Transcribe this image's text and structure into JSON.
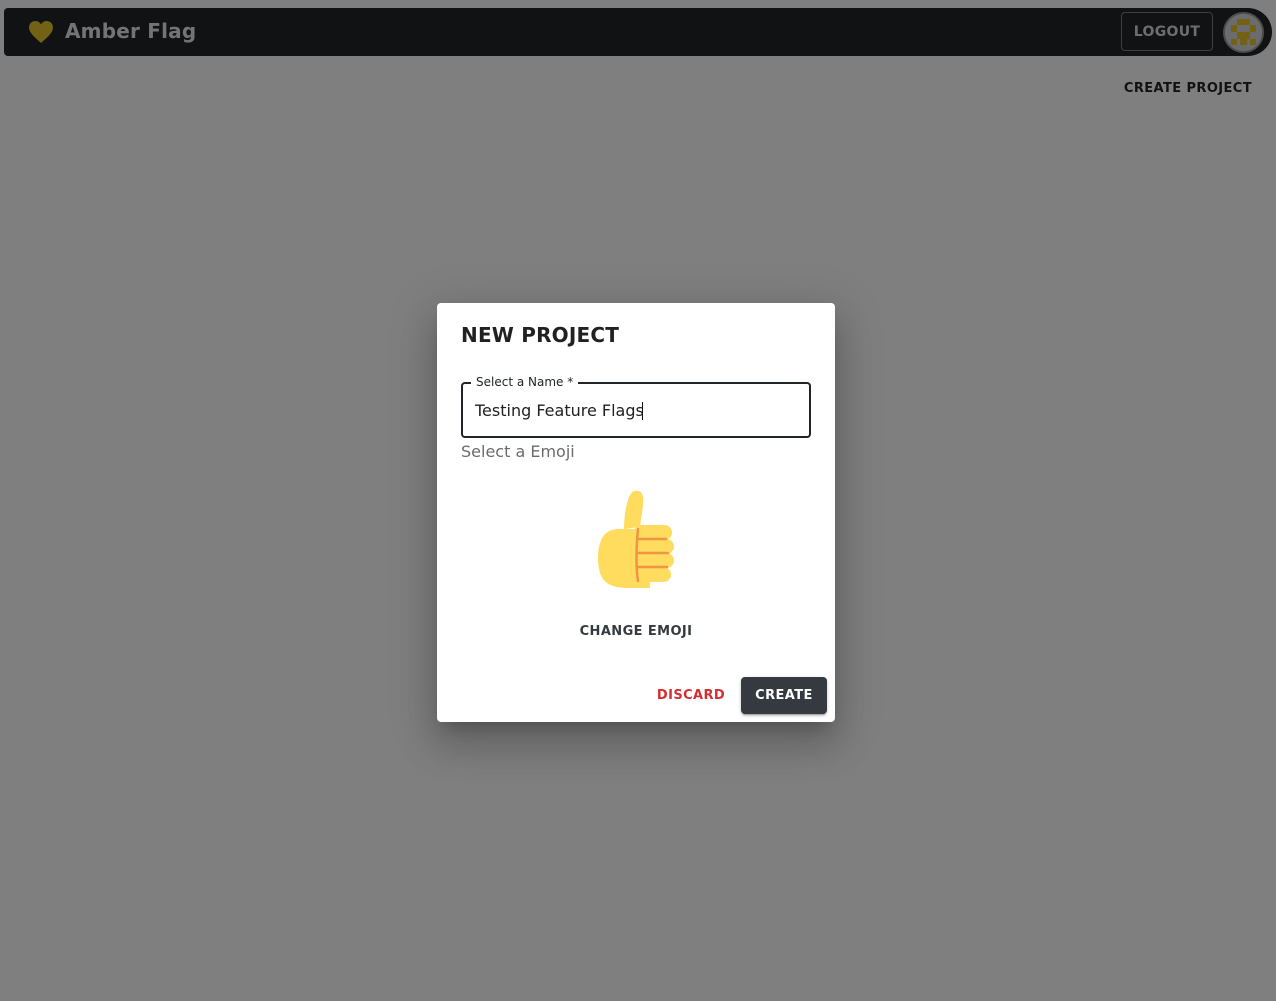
{
  "app": {
    "brand_name": "Amber Flag",
    "brand_icon": "heart-icon",
    "brand_color": "#e7c32b",
    "logout_label": "LOGOUT",
    "avatar_icon": "identicon-avatar",
    "create_project_label": "CREATE PROJECT"
  },
  "dialog": {
    "title": "NEW PROJECT",
    "name_field": {
      "label": "Select a Name",
      "required_marker": "*",
      "value": "Testing Feature Flags"
    },
    "emoji_label": "Select a Emoji",
    "selected_emoji": "thumbs-up-icon",
    "change_emoji_label": "CHANGE EMOJI",
    "discard_label": "DISCARD",
    "create_label": "CREATE"
  },
  "colors": {
    "app_bar": "#212529",
    "backdrop": "rgba(0,0,0,0.5)",
    "discard": "#d32f2f",
    "create_button": "#343a40"
  }
}
